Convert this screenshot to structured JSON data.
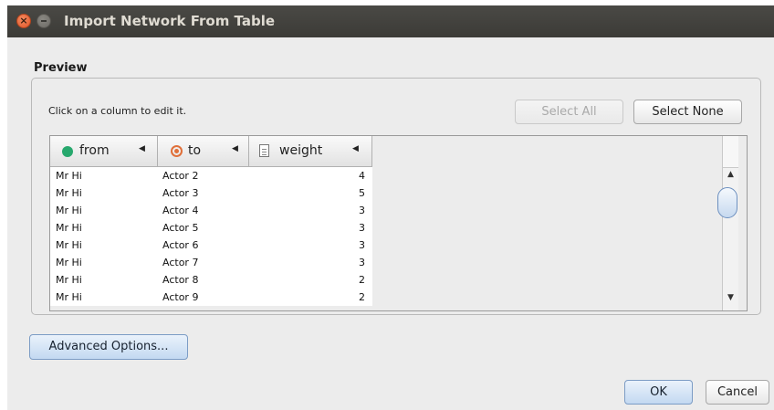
{
  "window": {
    "title": "Import Network From Table"
  },
  "preview": {
    "label": "Preview",
    "hint": "Click on a column to edit it.",
    "select_all_label": "Select All",
    "select_none_label": "Select None"
  },
  "table": {
    "columns": [
      {
        "label": "from",
        "icon": "source-node-icon",
        "color": "#27a86d"
      },
      {
        "label": "to",
        "icon": "target-node-icon",
        "color": "#e0703a"
      },
      {
        "label": "weight",
        "icon": "edge-attribute-icon"
      }
    ],
    "rows": [
      {
        "from": "Mr Hi",
        "to": "Actor 2",
        "weight": "4"
      },
      {
        "from": "Mr Hi",
        "to": "Actor 3",
        "weight": "5"
      },
      {
        "from": "Mr Hi",
        "to": "Actor 4",
        "weight": "3"
      },
      {
        "from": "Mr Hi",
        "to": "Actor 5",
        "weight": "3"
      },
      {
        "from": "Mr Hi",
        "to": "Actor 6",
        "weight": "3"
      },
      {
        "from": "Mr Hi",
        "to": "Actor 7",
        "weight": "3"
      },
      {
        "from": "Mr Hi",
        "to": "Actor 8",
        "weight": "2"
      },
      {
        "from": "Mr Hi",
        "to": "Actor 9",
        "weight": "2"
      }
    ]
  },
  "advanced_options_label": "Advanced Options...",
  "footer": {
    "ok_label": "OK",
    "cancel_label": "Cancel"
  }
}
